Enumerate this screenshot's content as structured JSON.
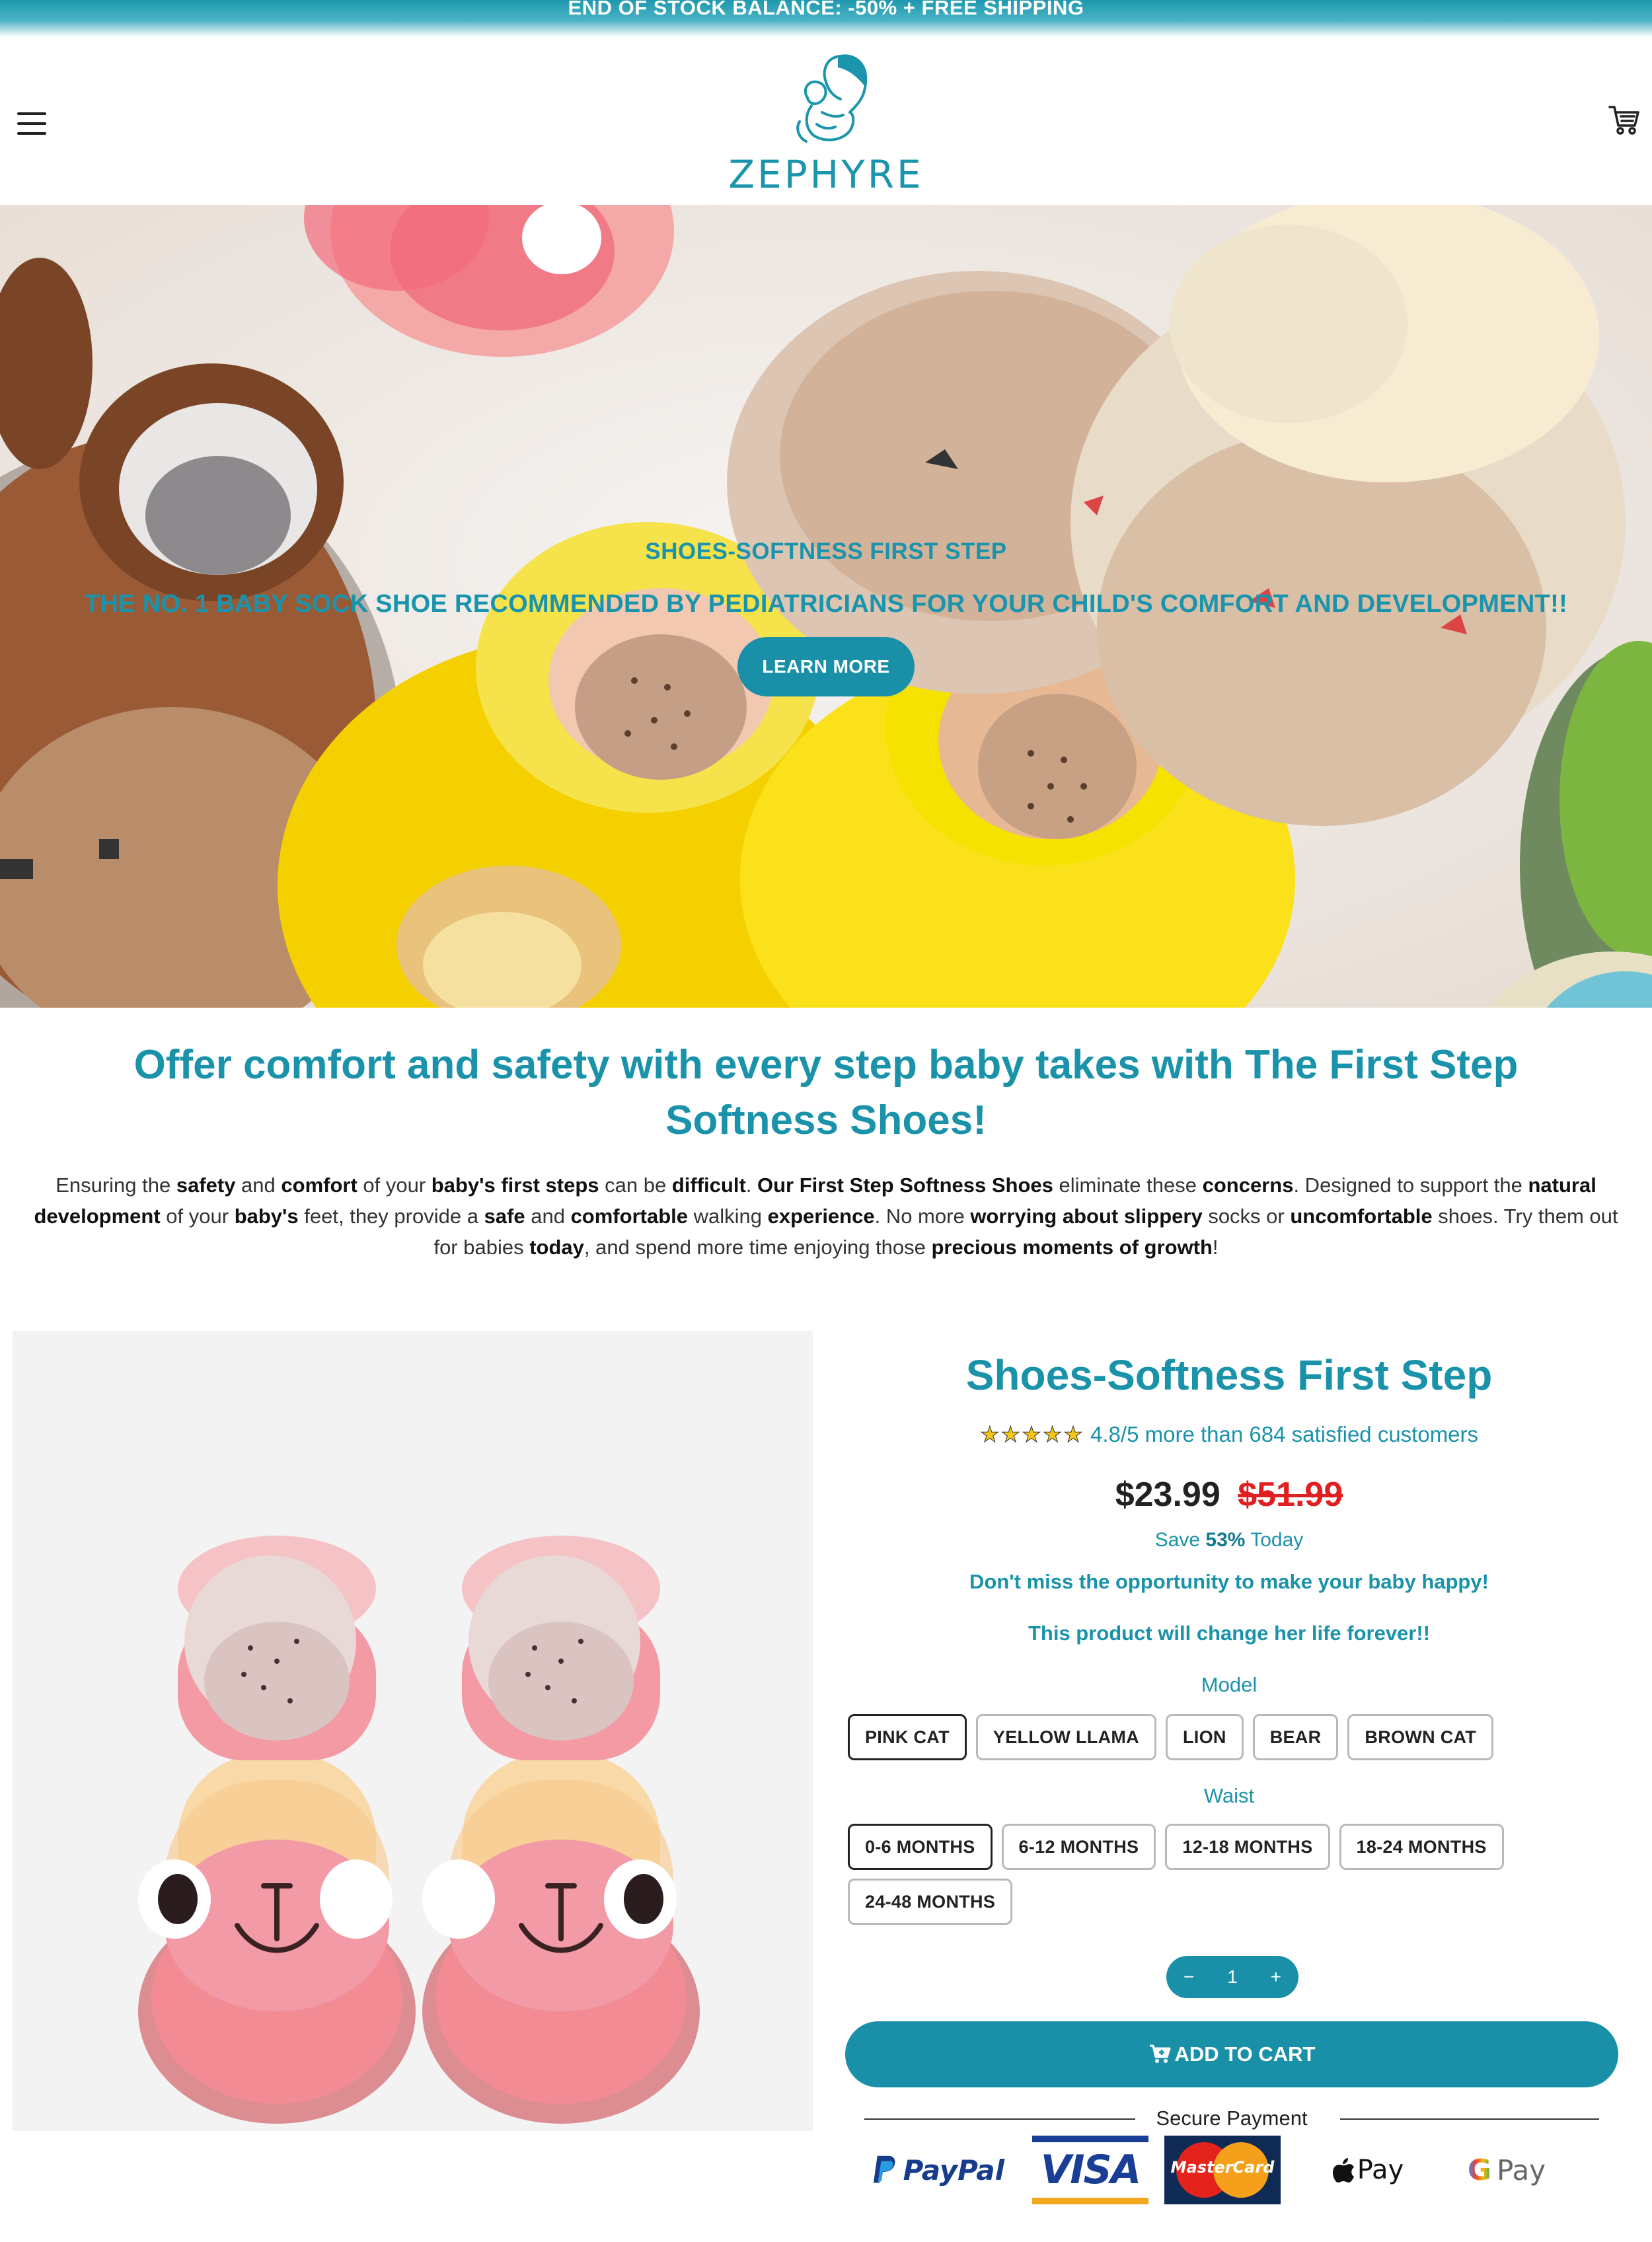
{
  "announcement": {
    "text": "END OF STOCK BALANCE: -50% + FREE SHIPPING"
  },
  "header": {
    "brand": "ZEPHYRE",
    "menu_icon": "hamburger-menu-icon",
    "cart_icon": "cart-icon"
  },
  "hero": {
    "subtitle": "SHOES-SOFTNESS FIRST STEP",
    "title": "THE NO. 1 BABY SOCK SHOE RECOMMENDED BY PEDIATRICIANS FOR YOUR CHILD'S COMFORT AND DEVELOPMENT!!",
    "button_label": "LEARN MORE"
  },
  "intro": {
    "title": "Offer comfort and safety with every step baby takes with The First Step Softness Shoes!",
    "paragraph": [
      {
        "t": "Ensuring the ",
        "b": false
      },
      {
        "t": "safety",
        "b": true
      },
      {
        "t": " and ",
        "b": false
      },
      {
        "t": "comfort",
        "b": true
      },
      {
        "t": " of your ",
        "b": false
      },
      {
        "t": "baby's first steps",
        "b": true
      },
      {
        "t": " can be ",
        "b": false
      },
      {
        "t": "difficult",
        "b": true
      },
      {
        "t": ". ",
        "b": false
      },
      {
        "t": "Our First Step Softness Shoes",
        "b": true
      },
      {
        "t": " eliminate these ",
        "b": false
      },
      {
        "t": "concerns",
        "b": true
      },
      {
        "t": ". Designed to support the ",
        "b": false
      },
      {
        "t": "natural development",
        "b": true
      },
      {
        "t": " of your ",
        "b": false
      },
      {
        "t": "baby's",
        "b": true
      },
      {
        "t": " feet, they provide a ",
        "b": false
      },
      {
        "t": "safe",
        "b": true
      },
      {
        "t": " and ",
        "b": false
      },
      {
        "t": "comfortable",
        "b": true
      },
      {
        "t": " walking ",
        "b": false
      },
      {
        "t": "experience",
        "b": true
      },
      {
        "t": ". No more ",
        "b": false
      },
      {
        "t": "worrying about slippery",
        "b": true
      },
      {
        "t": " socks or ",
        "b": false
      },
      {
        "t": "uncomfortable",
        "b": true
      },
      {
        "t": " shoes. Try them out for babies ",
        "b": false
      },
      {
        "t": "today",
        "b": true
      },
      {
        "t": ", and spend more time enjoying those ",
        "b": false
      },
      {
        "t": "precious moments of growth",
        "b": true
      },
      {
        "t": "!",
        "b": false
      }
    ]
  },
  "product": {
    "title": "Shoes-Softness First Step",
    "stars": "★★★★★",
    "rating_text": "4.8/5 more than 684 satisfied customers",
    "price": "$23.99",
    "compare_price": "$51.99",
    "save_prefix": "Save ",
    "save_value": "53%",
    "save_suffix": " Today",
    "promo_line_1": "Don't miss the opportunity to make your baby happy!",
    "promo_line_2": "This product will change her life forever!!",
    "model_label": "Model",
    "models": [
      "PINK CAT",
      "YELLOW LLAMA",
      "LION",
      "BEAR",
      "BROWN CAT"
    ],
    "selected_model": "PINK CAT",
    "waist_label": "Waist",
    "waists": [
      "0-6 MONTHS",
      "6-12 MONTHS",
      "12-18 MONTHS",
      "18-24 MONTHS",
      "24-48 MONTHS"
    ],
    "selected_waist": "0-6 MONTHS",
    "quantity": "1",
    "qty_minus": "−",
    "qty_plus": "+",
    "add_to_cart": "ADD TO CART",
    "secure_payment": "Secure Payment",
    "payments": [
      "PayPal",
      "VISA",
      "MasterCard",
      "Pay",
      "Pay"
    ]
  },
  "colors": {
    "accent": "#1a93aa",
    "sale_red": "#e02020",
    "star": "#f5c518"
  }
}
